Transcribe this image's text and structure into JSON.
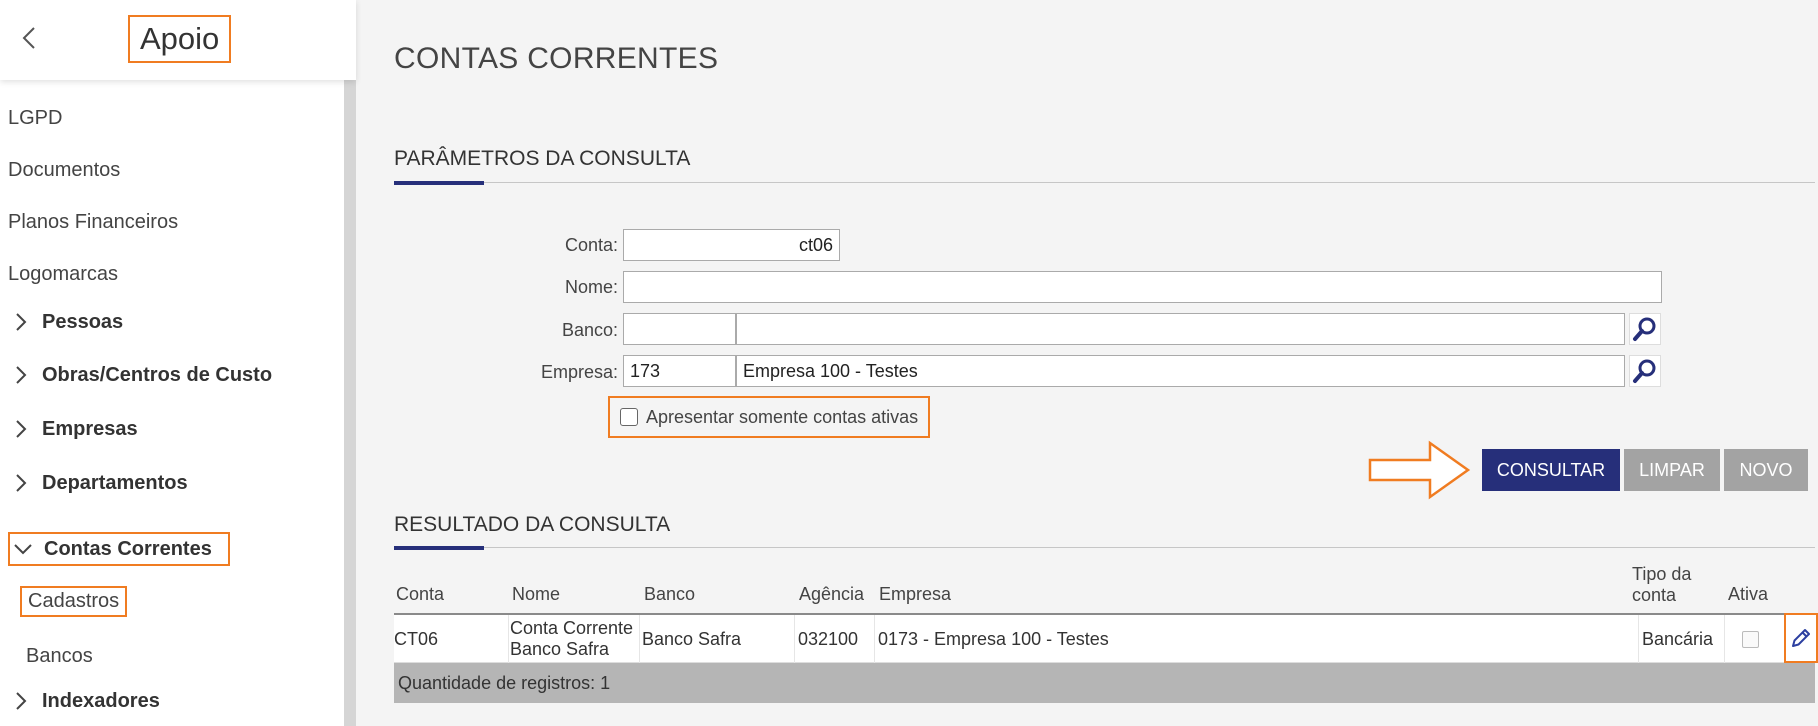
{
  "sidebar": {
    "title": "Apoio",
    "items": [
      "LGPD",
      "Documentos",
      "Planos Financeiros",
      "Logomarcas"
    ],
    "groups": [
      "Pessoas",
      "Obras/Centros de Custo",
      "Empresas",
      "Departamentos"
    ],
    "open_group": "Contas Correntes",
    "sub_items": [
      "Cadastros",
      "Bancos"
    ],
    "last_group": "Indexadores"
  },
  "page": {
    "title": "CONTAS CORRENTES"
  },
  "params": {
    "section_title": "PARÂMETROS DA CONSULTA",
    "conta_label": "Conta:",
    "conta_value": "ct06",
    "nome_label": "Nome:",
    "nome_value": "",
    "banco_label": "Banco:",
    "banco_code": "",
    "banco_name": "",
    "empresa_label": "Empresa:",
    "empresa_code": "173",
    "empresa_name": "Empresa 100 - Testes",
    "checkbox_label": "Apresentar somente contas ativas",
    "checkbox_checked": false
  },
  "buttons": {
    "consultar": "CONSULTAR",
    "limpar": "LIMPAR",
    "novo": "NOVO"
  },
  "results": {
    "section_title": "RESULTADO DA CONSULTA",
    "columns": [
      "Conta",
      "Nome",
      "Banco",
      "Agência",
      "Empresa",
      "Tipo da conta",
      "Ativa"
    ],
    "rows": [
      {
        "conta": "CT06",
        "nome": "Conta Corrente Banco Safra",
        "banco": "Banco Safra",
        "agencia": "032100",
        "empresa": "0173 - Empresa 100 - Testes",
        "tipo": "Bancária",
        "ativa": false
      }
    ],
    "footer": "Quantidade de registros: 1"
  },
  "colors": {
    "primary": "#262f7a",
    "highlight": "#f07c21",
    "grey_button": "#a3a3a3"
  },
  "icons": [
    "chevron-left-icon",
    "chevron-right-icon",
    "chevron-down-icon",
    "search-icon",
    "arrow-right-icon",
    "pencil-icon"
  ]
}
